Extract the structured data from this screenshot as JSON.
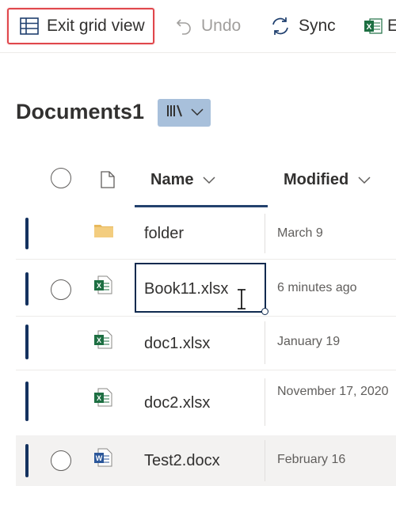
{
  "toolbar": {
    "exit_label": "Exit grid view",
    "undo_label": "Undo",
    "sync_label": "Sync",
    "excel_partial_label": "E"
  },
  "library": {
    "title": "Documents1"
  },
  "columns": {
    "name": "Name",
    "modified": "Modified"
  },
  "rows": [
    {
      "name": "folder",
      "modified": "March 9",
      "type": "folder"
    },
    {
      "name": "Book11.xlsx",
      "modified": "6 minutes ago",
      "type": "xlsx"
    },
    {
      "name": "doc1.xlsx",
      "modified": "January 19",
      "type": "xlsx"
    },
    {
      "name": "doc2.xlsx",
      "modified": "November 17, 2020",
      "type": "xlsx"
    },
    {
      "name": "Test2.docx",
      "modified": "February 16",
      "type": "docx"
    }
  ],
  "colors": {
    "accent": "#14325f",
    "highlight_border": "#e0474c",
    "view_chip": "#a8c0db",
    "excel": "#1d6f42",
    "word": "#2b579a"
  }
}
